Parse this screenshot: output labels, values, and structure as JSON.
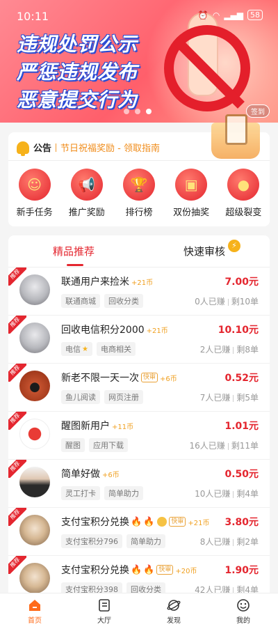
{
  "status": {
    "time": "10:11",
    "battery": "58"
  },
  "banner": {
    "line1": "违规处罚公示",
    "line2": "严惩违规发布",
    "line3": "恶意提交行为",
    "signin": "签到",
    "dots": 3,
    "active_dot": 2
  },
  "notice": {
    "tag": "公告",
    "message": "节日祝福奖励 - 领取指南"
  },
  "quick_actions": [
    {
      "label": "新手任务",
      "icon": "person-board-icon"
    },
    {
      "label": "推广奖励",
      "icon": "megaphone-icon"
    },
    {
      "label": "排行榜",
      "icon": "trophy-icon"
    },
    {
      "label": "双份抽奖",
      "icon": "treasure-chest-icon"
    },
    {
      "label": "超级裂变",
      "icon": "coins-bag-icon"
    }
  ],
  "tabs": {
    "featured": "精品推荐",
    "fast_review": "快速审核"
  },
  "ribbon": "推荐",
  "tasks": [
    {
      "title": "联通用户来捡米",
      "coins": "+21币",
      "price": "7.00元",
      "tags": [
        "联通商城",
        "回收分类"
      ],
      "earned": "0人已赚",
      "remaining": "剩10单"
    },
    {
      "title": "回收电信积分2000",
      "coins": "+21币",
      "price": "10.10元",
      "tags": [
        "电信",
        "电商相关"
      ],
      "earned": "2人已赚",
      "remaining": "剩8单"
    },
    {
      "title": "新老不限一天一次",
      "badge": "快审",
      "coins": "+6币",
      "price": "0.52元",
      "tags": [
        "鱼儿阅读",
        "网页注册"
      ],
      "earned": "7人已赚",
      "remaining": "剩5单"
    },
    {
      "title": "醒图新用户",
      "coins": "+11币",
      "price": "1.01元",
      "tags": [
        "醒图",
        "应用下载"
      ],
      "earned": "16人已赚",
      "remaining": "剩11单"
    },
    {
      "title": "简单好做",
      "coins": "+6币",
      "price": "0.50元",
      "tags": [
        "灵工打卡",
        "简单助力"
      ],
      "earned": "10人已赚",
      "remaining": "剩4单"
    },
    {
      "title": "支付宝积分兑换",
      "badge": "快审",
      "coins": "+21币",
      "price": "3.80元",
      "tags": [
        "支付宝积分796",
        "简单助力"
      ],
      "earned": "8人已赚",
      "remaining": "剩2单"
    },
    {
      "title": "支付宝积分兑换",
      "badge": "快审",
      "coins": "+20币",
      "price": "1.90元",
      "tags": [
        "支付宝积分398",
        "回收分类"
      ],
      "earned": "42人已赚",
      "remaining": "剩4单"
    }
  ],
  "nav": [
    {
      "label": "首页",
      "icon": "home-icon",
      "active": true
    },
    {
      "label": "大厅",
      "icon": "list-icon",
      "active": false
    },
    {
      "label": "发现",
      "icon": "planet-icon",
      "active": false
    },
    {
      "label": "我的",
      "icon": "smiley-icon",
      "active": false
    }
  ],
  "colors": {
    "accent": "#e4262f",
    "orange": "#ff6b1a",
    "coin": "#f0a020"
  }
}
